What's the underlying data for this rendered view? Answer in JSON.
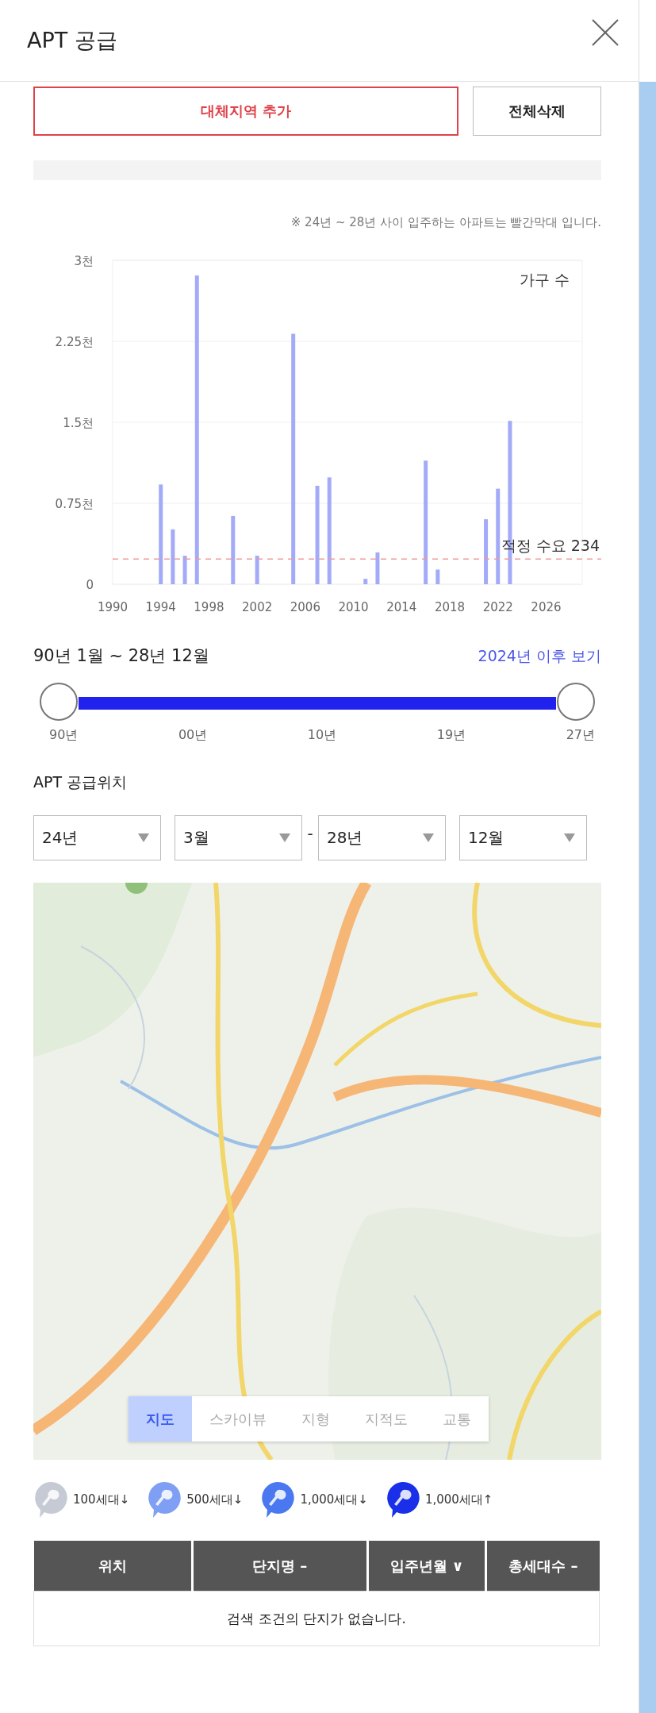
{
  "panel": {
    "title": "APT 공급"
  },
  "actions": {
    "add_button": "대체지역 추가",
    "clear_button": "전체삭제"
  },
  "note": "※ 24년 ~ 28년 사이 입주하는 아파트는 빨간막대 입니다.",
  "chart_data": {
    "type": "bar",
    "x": [
      1994,
      1995,
      1996,
      1997,
      2000,
      2002,
      2005,
      2007,
      2008,
      2011,
      2012,
      2016,
      2017,
      2021,
      2022,
      2023
    ],
    "ylabel": "가구 수",
    "grid": true,
    "series": [
      {
        "color": "#a3aaf7",
        "values": [
          0.924,
          0.508,
          0.264,
          2.86,
          0.633,
          0.264,
          2.32,
          0.912,
          0.99,
          0.05,
          0.295,
          1.145,
          0.136,
          0.602,
          0.885,
          1.513
        ]
      }
    ],
    "xlim": [
      1990,
      2029
    ],
    "ylim": [
      0,
      3
    ],
    "xticks": [
      1990,
      1994,
      1998,
      2002,
      2006,
      2010,
      2014,
      2018,
      2022,
      2026
    ],
    "yticks": [
      {
        "value": 0,
        "label": "0"
      },
      {
        "value": 0.75,
        "label": "0.75천"
      },
      {
        "value": 1.5,
        "label": "1.5천"
      },
      {
        "value": 2.25,
        "label": "2.25천"
      },
      {
        "value": 3,
        "label": "3천"
      }
    ],
    "ref_lines": [
      {
        "axis": "y",
        "value": 0.234,
        "label": "적정 수요 234",
        "color": "#f29a9a"
      }
    ]
  },
  "period": {
    "label": "90년 1월 ~ 28년 12월",
    "link": "2024년 이후 보기"
  },
  "range_slider": {
    "ticks": [
      "90년",
      "00년",
      "10년",
      "19년",
      "27년"
    ]
  },
  "location": {
    "title": "APT 공급위치",
    "selects": [
      {
        "value": "24년"
      },
      {
        "value": "3월"
      },
      {
        "value": "28년"
      },
      {
        "value": "12월"
      }
    ],
    "separator": "-"
  },
  "map": {
    "kind": "picture",
    "tabs": [
      {
        "label": "지도",
        "selected": true
      },
      {
        "label": "스카이뷰",
        "selected": false
      },
      {
        "label": "지형",
        "selected": false
      },
      {
        "label": "지적도",
        "selected": false
      },
      {
        "label": "교통",
        "selected": false
      }
    ]
  },
  "legend": [
    {
      "label": "100세대↓",
      "color": "#c5cad4"
    },
    {
      "label": "500세대↓",
      "color": "#7f9ff5"
    },
    {
      "label": "1,000세대↓",
      "color": "#4a78f0"
    },
    {
      "label": "1,000세대↑",
      "color": "#1a2fe8"
    }
  ],
  "table": {
    "columns": [
      "위치",
      "단지명 –",
      "입주년월 ∨",
      "총세대수 –"
    ],
    "empty_message": "검색 조건의 단지가 없습니다."
  }
}
